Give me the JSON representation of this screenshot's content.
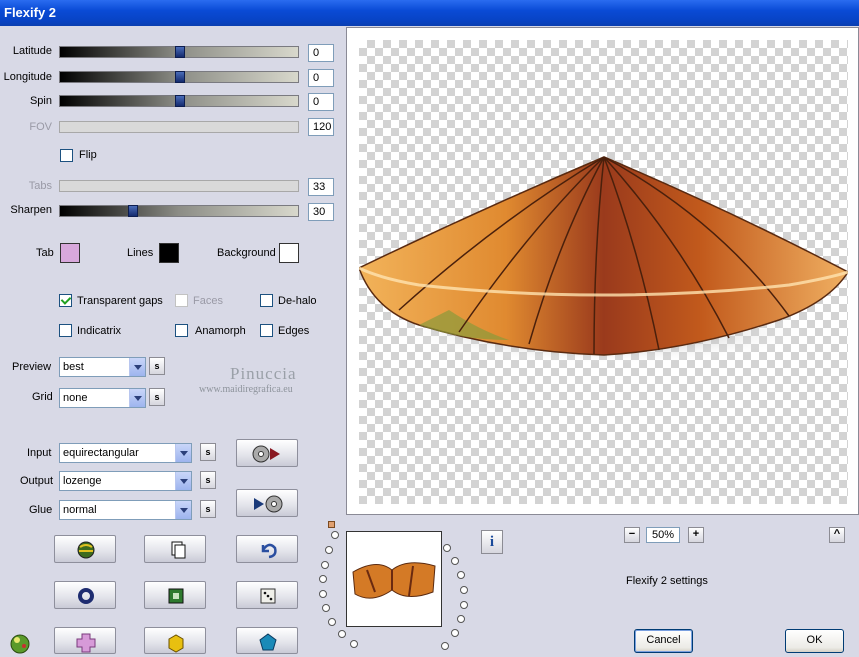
{
  "window": {
    "title": "Flexify 2"
  },
  "sliders": [
    {
      "label": "Latitude",
      "value": "0",
      "enabled": true,
      "level": 0.5
    },
    {
      "label": "Longitude",
      "value": "0",
      "enabled": true,
      "level": 0.5
    },
    {
      "label": "Spin",
      "value": "0",
      "enabled": true,
      "level": 0.5
    },
    {
      "label": "FOV",
      "value": "120",
      "enabled": false
    },
    {
      "label": "Tabs",
      "value": "33",
      "enabled": false
    },
    {
      "label": "Sharpen",
      "value": "30",
      "enabled": true,
      "level": 0.3
    }
  ],
  "flip": {
    "label": "Flip",
    "checked": false
  },
  "colors": {
    "tab": {
      "label": "Tab",
      "color": "#d8a8dc"
    },
    "lines": {
      "label": "Lines",
      "color": "#000000"
    },
    "background": {
      "label": "Background",
      "color": "#ffffff"
    }
  },
  "options": {
    "transparent_gaps": {
      "label": "Transparent gaps",
      "checked": true
    },
    "faces": {
      "label": "Faces",
      "checked": false,
      "enabled": false
    },
    "de_halo": {
      "label": "De-halo",
      "checked": false
    },
    "indicatrix": {
      "label": "Indicatrix",
      "checked": false
    },
    "anamorph": {
      "label": "Anamorph",
      "checked": false
    },
    "edges": {
      "label": "Edges",
      "checked": false
    }
  },
  "preview": {
    "label": "Preview",
    "value": "best"
  },
  "grid": {
    "label": "Grid",
    "value": "none"
  },
  "input": {
    "label": "Input",
    "value": "equirectangular"
  },
  "output": {
    "label": "Output",
    "value": "lozenge"
  },
  "glue": {
    "label": "Glue",
    "value": "normal"
  },
  "s_button": "s",
  "watermark": {
    "name": "Pinuccia",
    "site": "www.maidiregrafica.eu"
  },
  "zoom": {
    "minus": "−",
    "value": "50%",
    "plus": "+"
  },
  "up_button": "^",
  "info_button": "i",
  "settings_text": "Flexify 2 settings",
  "buttons": {
    "cancel": "Cancel",
    "ok": "OK"
  }
}
